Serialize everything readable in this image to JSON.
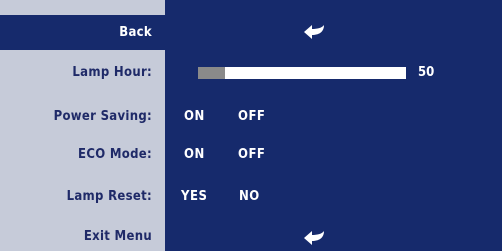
{
  "menu": {
    "back": {
      "label": "Back",
      "icon": "return-arrow-icon"
    },
    "lamp_hour": {
      "label": "Lamp Hour:",
      "value": "50",
      "bar_fraction": 0.13
    },
    "power_saving": {
      "label": "Power Saving:",
      "options": [
        "ON",
        "OFF"
      ]
    },
    "eco_mode": {
      "label": "ECO Mode:",
      "options": [
        "ON",
        "OFF"
      ]
    },
    "lamp_reset": {
      "label": "Lamp Reset:",
      "options": [
        "YES",
        "NO"
      ]
    },
    "exit_menu": {
      "label": "Exit Menu",
      "icon": "return-arrow-icon"
    }
  },
  "colors": {
    "panel_dark": "#162a6c",
    "panel_light": "#c6cbd9",
    "label_text": "#1f2a68",
    "bar_fill": "#8a8a8a"
  }
}
